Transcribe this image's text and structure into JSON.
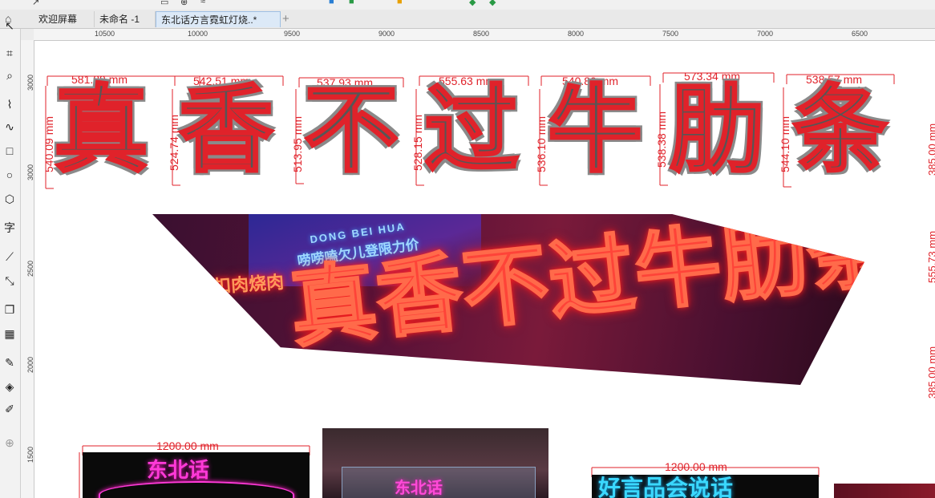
{
  "tabs": [
    {
      "label": "欢迎屏幕",
      "active": false
    },
    {
      "label": "未命名 -1",
      "active": false
    },
    {
      "label": "东北话方言霓虹灯烧..*",
      "active": true
    }
  ],
  "ruler": {
    "h_labels": [
      "10500",
      "10000",
      "9500",
      "9000",
      "8500",
      "8000",
      "7500",
      "7000",
      "6500"
    ],
    "v_labels": [
      "3000",
      "3000",
      "2500",
      "2000",
      "1500"
    ]
  },
  "tools": [
    "pointer-icon",
    "crop-icon",
    "zoom-icon",
    "freehand-icon",
    "artistic-media-icon",
    "rectangle-icon",
    "ellipse-icon",
    "polygon-icon",
    "text-icon",
    "dimension-icon",
    "connector-icon",
    "drop-shadow-icon",
    "transparency-icon",
    "eyedropper-icon",
    "fill-icon",
    "outline-pen-icon",
    "add-icon"
  ],
  "dimensions": {
    "widths": [
      "581.89 mm",
      "542.51 mm",
      "537.93 mm",
      "555.63 mm",
      "540.80 mm",
      "573.34 mm",
      "538.57 mm"
    ],
    "heights": [
      "540.09 mm",
      "524.74 mm",
      "513.95 mm",
      "528.15 mm",
      "536.10 mm",
      "538.38 mm",
      "544.10 mm"
    ],
    "right_edge": [
      "385.00 mm",
      "555.73 mm",
      "385.00 mm"
    ],
    "bottom_left": "1200.00 mm",
    "bottom_right": "1200.00 mm"
  },
  "glyphs": [
    "真",
    "香",
    "不",
    "过",
    "牛",
    "肋",
    "条"
  ],
  "photo_main": {
    "neon_red": "真香不过牛肋条",
    "neon_left": "扣肉烧肉",
    "neon_blue": "DONG BEI HUA",
    "neon_blue2": "唠唠嗑欠儿登限力价"
  },
  "photo_bottom_left": {
    "neon": "东北话"
  },
  "photo_bottom_mid": {
    "neon": "东北话"
  },
  "photo_bottom_right": {
    "neon": "好言品会说话"
  }
}
